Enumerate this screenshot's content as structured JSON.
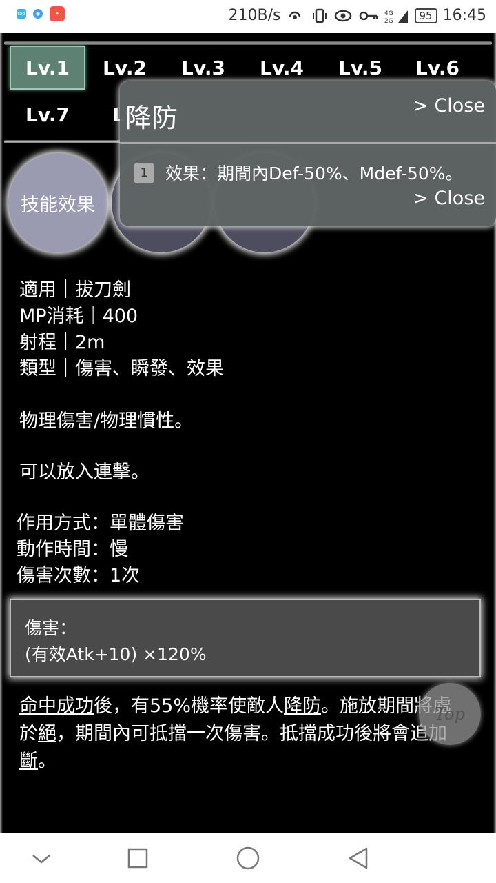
{
  "status_bar": {
    "speed": "210B/s",
    "battery": "95",
    "time": "16:45"
  },
  "tabs": [
    "Lv.1",
    "Lv.2",
    "Lv.3",
    "Lv.4",
    "Lv.5",
    "Lv.6",
    "Lv.7",
    "Lv"
  ],
  "circles": {
    "skill_effect": "技能效果"
  },
  "info": {
    "applicable": "適用｜拔刀劍",
    "mp_cost": "MP消耗｜400",
    "range": "射程｜2m",
    "type": "類型｜傷害、瞬發、效果",
    "damage_kind": "物理傷害/物理慣性。",
    "combo": "可以放入連擊。",
    "method": "作用方式：單體傷害",
    "action_time": "動作時間：慢",
    "hit_count": "傷害次數：1次"
  },
  "damage_box": {
    "label": "傷害：",
    "formula": "(有效Atk+10) ×120%"
  },
  "description": {
    "link1": "命中成功",
    "text1": "後，有55%機率使敵人",
    "link2": "降防",
    "text2": "。施放期間將處於",
    "link3": "絕",
    "text3": "，期間內可抵擋一次傷害。抵擋成功後將會追加",
    "link4": "斷",
    "text4": "。"
  },
  "top_button": "Top",
  "popup": {
    "title": "降防",
    "close_top": "> Close",
    "close_bottom": "> Close",
    "item_number": "1",
    "effect": "效果：期間內Def-50%、Mdef-50%。"
  },
  "colors": {
    "active_tab": "#5d8172",
    "popup_bg": "#5f6464",
    "damage_box_bg": "#4a4a4a"
  }
}
